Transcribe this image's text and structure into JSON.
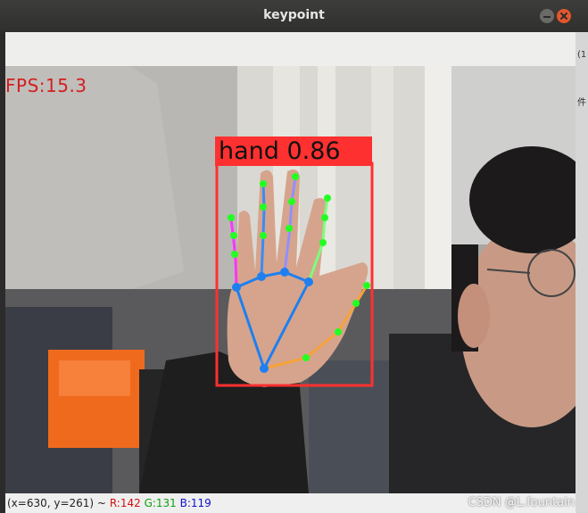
{
  "window": {
    "title": "keypoint"
  },
  "overlay": {
    "fps_text": "FPS:15.3"
  },
  "detection": {
    "label": "hand 0.86"
  },
  "status": {
    "coord": "(x=630, y=261) ~",
    "r": "R:142",
    "g": "G:131",
    "b": "B:119"
  },
  "watermark": "CSDN @L.fountain",
  "right_strip": {
    "text1": "(1",
    "text2": "件"
  },
  "colors": {
    "box": "#ff3030",
    "keypoint": "#22ff22",
    "palm_lines": "#1e7ff0"
  }
}
